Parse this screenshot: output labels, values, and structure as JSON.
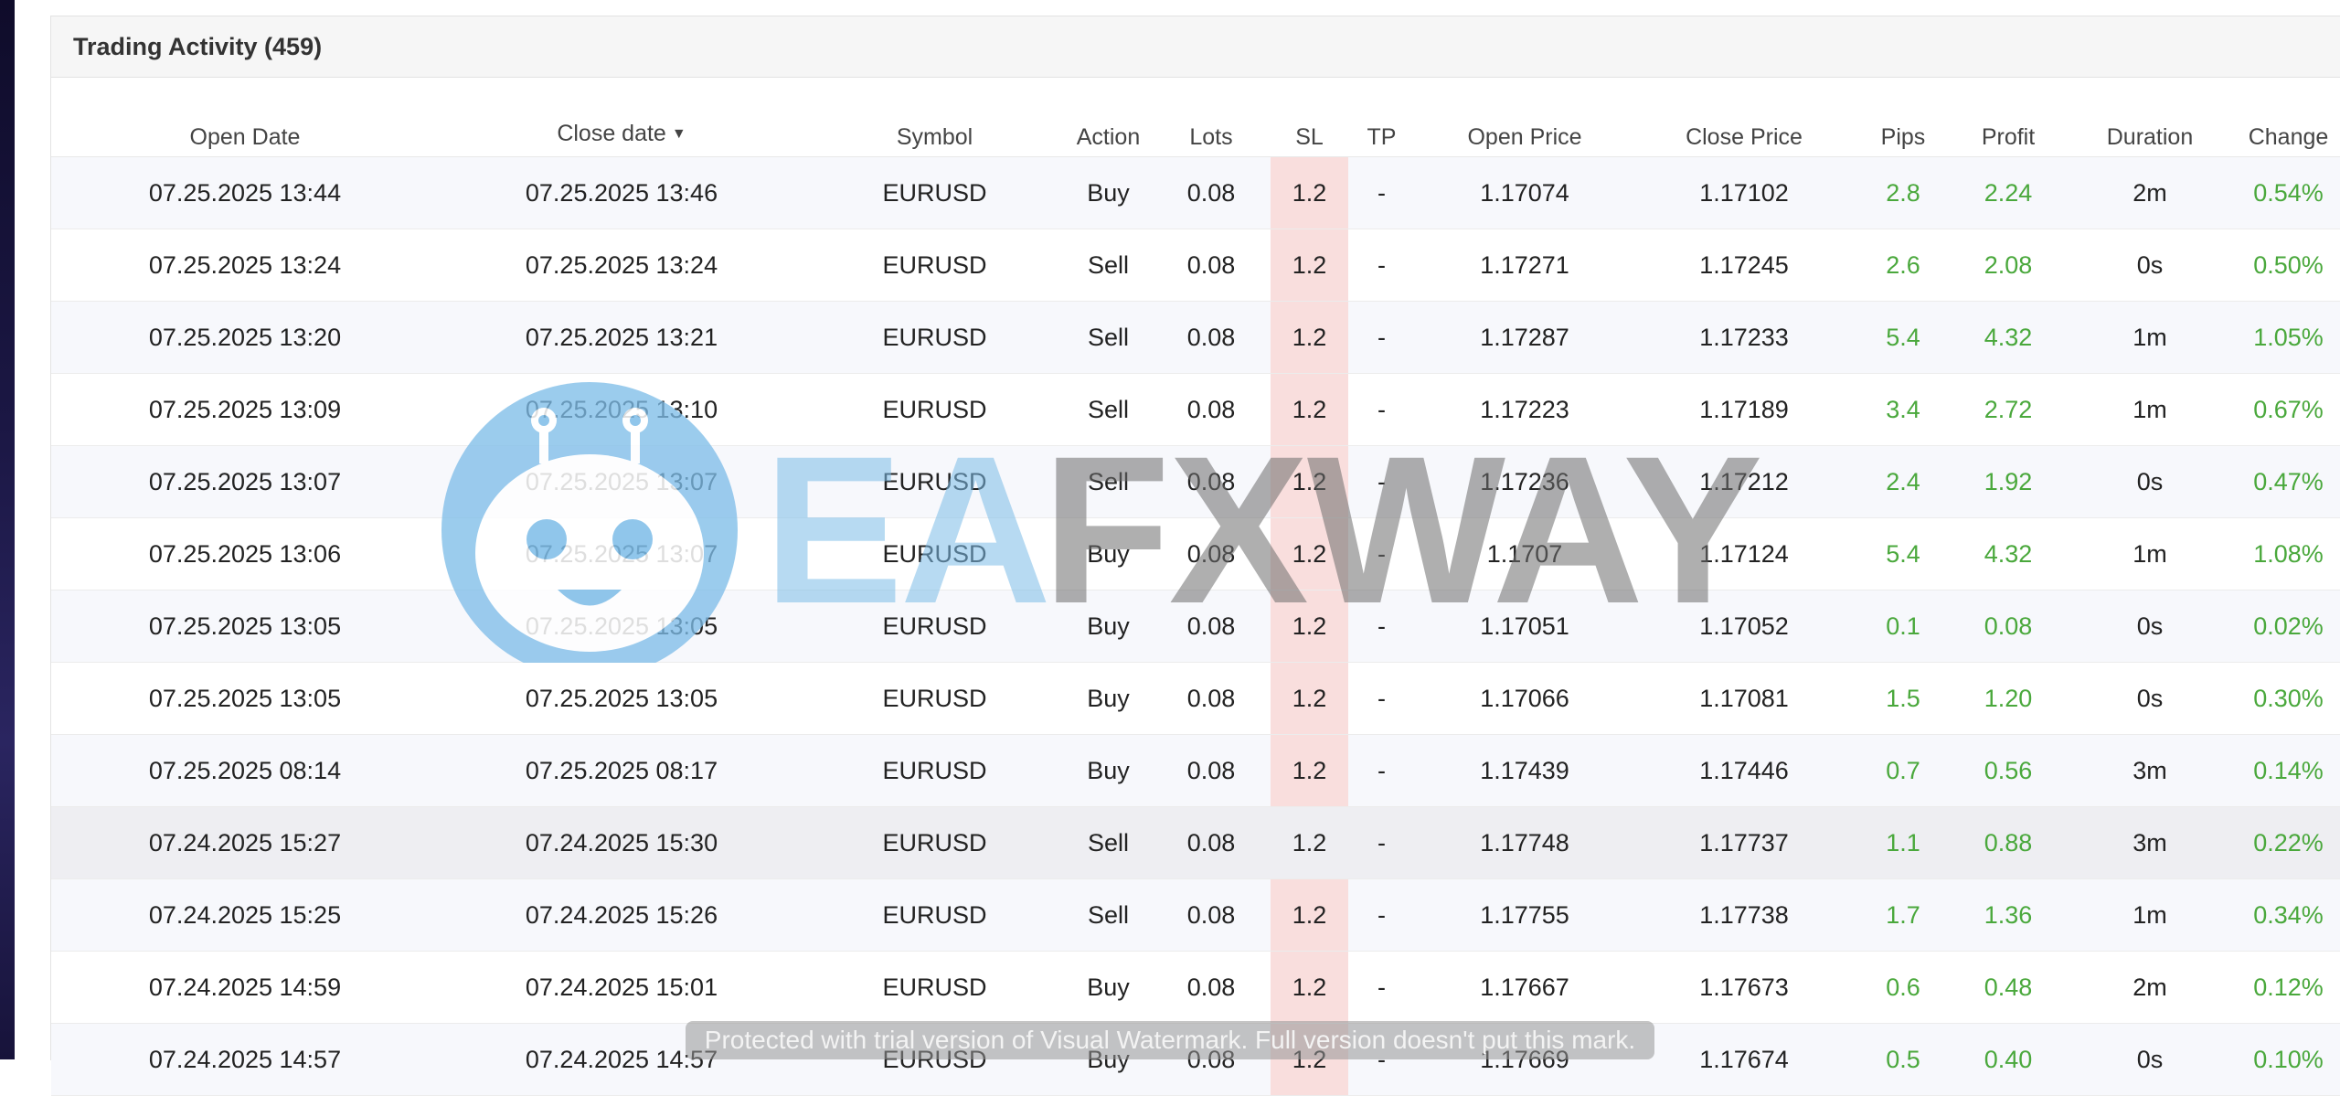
{
  "panel": {
    "title": "Trading Activity (459)"
  },
  "columns": {
    "open_date": "Open Date",
    "close_date": "Close date",
    "close_sort": "▼",
    "symbol": "Symbol",
    "action": "Action",
    "lots": "Lots",
    "sl": "SL",
    "tp": "TP",
    "open_price": "Open Price",
    "close_price": "Close Price",
    "pips": "Pips",
    "profit": "Profit",
    "duration": "Duration",
    "change": "Change"
  },
  "rows": [
    {
      "open": "07.25.2025 13:44",
      "close": "07.25.2025 13:46",
      "symbol": "EURUSD",
      "action": "Buy",
      "lots": "0.08",
      "sl": "1.2",
      "tp": "-",
      "open_price": "1.17074",
      "close_price": "1.17102",
      "pips": "2.8",
      "profit": "2.24",
      "duration": "2m",
      "change": "0.54%"
    },
    {
      "open": "07.25.2025 13:24",
      "close": "07.25.2025 13:24",
      "symbol": "EURUSD",
      "action": "Sell",
      "lots": "0.08",
      "sl": "1.2",
      "tp": "-",
      "open_price": "1.17271",
      "close_price": "1.17245",
      "pips": "2.6",
      "profit": "2.08",
      "duration": "0s",
      "change": "0.50%"
    },
    {
      "open": "07.25.2025 13:20",
      "close": "07.25.2025 13:21",
      "symbol": "EURUSD",
      "action": "Sell",
      "lots": "0.08",
      "sl": "1.2",
      "tp": "-",
      "open_price": "1.17287",
      "close_price": "1.17233",
      "pips": "5.4",
      "profit": "4.32",
      "duration": "1m",
      "change": "1.05%"
    },
    {
      "open": "07.25.2025 13:09",
      "close": "07.25.2025 13:10",
      "symbol": "EURUSD",
      "action": "Sell",
      "lots": "0.08",
      "sl": "1.2",
      "tp": "-",
      "open_price": "1.17223",
      "close_price": "1.17189",
      "pips": "3.4",
      "profit": "2.72",
      "duration": "1m",
      "change": "0.67%"
    },
    {
      "open": "07.25.2025 13:07",
      "close": "07.25.2025 13:07",
      "symbol": "EURUSD",
      "action": "Sell",
      "lots": "0.08",
      "sl": "1.2",
      "tp": "-",
      "open_price": "1.17236",
      "close_price": "1.17212",
      "pips": "2.4",
      "profit": "1.92",
      "duration": "0s",
      "change": "0.47%"
    },
    {
      "open": "07.25.2025 13:06",
      "close": "07.25.2025 13:07",
      "symbol": "EURUSD",
      "action": "Buy",
      "lots": "0.08",
      "sl": "1.2",
      "tp": "-",
      "open_price": "1.1707",
      "close_price": "1.17124",
      "pips": "5.4",
      "profit": "4.32",
      "duration": "1m",
      "change": "1.08%"
    },
    {
      "open": "07.25.2025 13:05",
      "close": "07.25.2025 13:05",
      "symbol": "EURUSD",
      "action": "Buy",
      "lots": "0.08",
      "sl": "1.2",
      "tp": "-",
      "open_price": "1.17051",
      "close_price": "1.17052",
      "pips": "0.1",
      "profit": "0.08",
      "duration": "0s",
      "change": "0.02%"
    },
    {
      "open": "07.25.2025 13:05",
      "close": "07.25.2025 13:05",
      "symbol": "EURUSD",
      "action": "Buy",
      "lots": "0.08",
      "sl": "1.2",
      "tp": "-",
      "open_price": "1.17066",
      "close_price": "1.17081",
      "pips": "1.5",
      "profit": "1.20",
      "duration": "0s",
      "change": "0.30%"
    },
    {
      "open": "07.25.2025 08:14",
      "close": "07.25.2025 08:17",
      "symbol": "EURUSD",
      "action": "Buy",
      "lots": "0.08",
      "sl": "1.2",
      "tp": "-",
      "open_price": "1.17439",
      "close_price": "1.17446",
      "pips": "0.7",
      "profit": "0.56",
      "duration": "3m",
      "change": "0.14%"
    },
    {
      "open": "07.24.2025 15:27",
      "close": "07.24.2025 15:30",
      "symbol": "EURUSD",
      "action": "Sell",
      "lots": "0.08",
      "sl": "1.2",
      "tp": "-",
      "open_price": "1.17748",
      "close_price": "1.17737",
      "pips": "1.1",
      "profit": "0.88",
      "duration": "3m",
      "change": "0.22%"
    },
    {
      "open": "07.24.2025 15:25",
      "close": "07.24.2025 15:26",
      "symbol": "EURUSD",
      "action": "Sell",
      "lots": "0.08",
      "sl": "1.2",
      "tp": "-",
      "open_price": "1.17755",
      "close_price": "1.17738",
      "pips": "1.7",
      "profit": "1.36",
      "duration": "1m",
      "change": "0.34%"
    },
    {
      "open": "07.24.2025 14:59",
      "close": "07.24.2025 15:01",
      "symbol": "EURUSD",
      "action": "Buy",
      "lots": "0.08",
      "sl": "1.2",
      "tp": "-",
      "open_price": "1.17667",
      "close_price": "1.17673",
      "pips": "0.6",
      "profit": "0.48",
      "duration": "2m",
      "change": "0.12%"
    },
    {
      "open": "07.24.2025 14:57",
      "close": "07.24.2025 14:57",
      "symbol": "EURUSD",
      "action": "Buy",
      "lots": "0.08",
      "sl": "1.2",
      "tp": "-",
      "open_price": "1.17669",
      "close_price": "1.17674",
      "pips": "0.5",
      "profit": "0.40",
      "duration": "0s",
      "change": "0.10%"
    }
  ],
  "watermark": {
    "ea": "EA",
    "fxway": "FXWAY"
  },
  "trial_banner": "Protected with trial version of Visual Watermark. Full version doesn't put this mark.",
  "colors": {
    "positive": "#4aa83c",
    "sl_highlight": "#f9dedd",
    "robot": "#7dbde8"
  }
}
